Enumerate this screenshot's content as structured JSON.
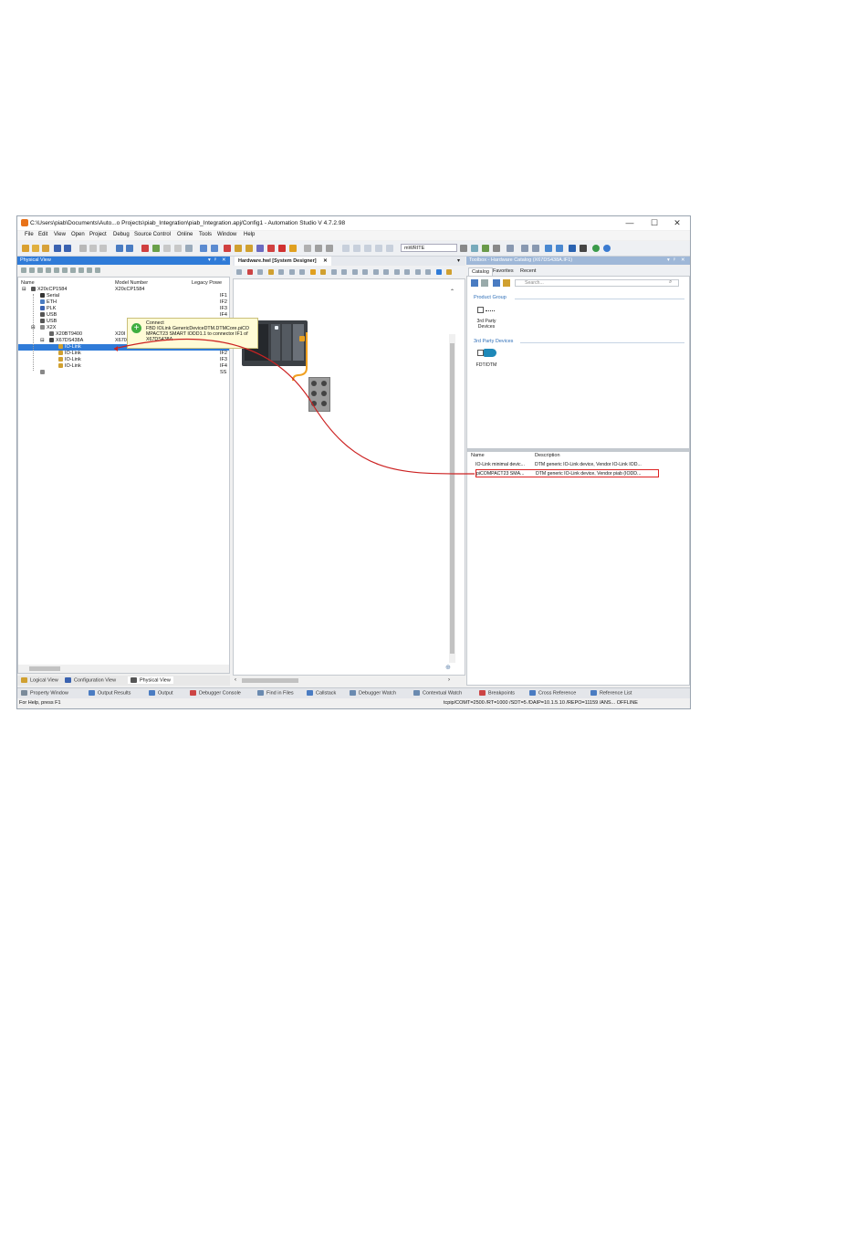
{
  "window": {
    "title": "C:\\Users\\piab\\Documents\\Auto...o Projects\\piab_Integration\\piab_Integration.apj/Config1 - Automation Studio V 4.7.2.98",
    "controls": [
      "—",
      "☐",
      "✕"
    ]
  },
  "menu": [
    "File",
    "Edit",
    "View",
    "Open",
    "Project",
    "Debug",
    "Source Control",
    "Online",
    "Tools",
    "Window",
    "Help"
  ],
  "toolbar": {
    "mode_select": "mWRITE"
  },
  "physical_view": {
    "title": "Physical View",
    "header_buttons": [
      "▾",
      "ᵖ",
      "✕"
    ],
    "columns": {
      "name": "Name",
      "model": "Model Number",
      "legacy": "Legacy Powe"
    },
    "rows": [
      {
        "name": "X20cCP1584",
        "model": "X20cCP1584",
        "port": "",
        "indent": 0,
        "expander": "⊟",
        "selected": false
      },
      {
        "name": "Serial",
        "model": "",
        "port": "IF1",
        "indent": 1,
        "expander": "",
        "selected": false
      },
      {
        "name": "ETH",
        "model": "",
        "port": "IF2",
        "indent": 1,
        "expander": "",
        "selected": false
      },
      {
        "name": "PLK",
        "model": "",
        "port": "IF3",
        "indent": 1,
        "expander": "",
        "selected": false
      },
      {
        "name": "USB",
        "model": "",
        "port": "IF4",
        "indent": 1,
        "expander": "",
        "selected": false
      },
      {
        "name": "USB",
        "model": "",
        "port": "",
        "indent": 1,
        "expander": "",
        "selected": false
      },
      {
        "name": "X2X",
        "model": "",
        "port": "",
        "indent": 1,
        "expander": "⊟",
        "selected": false
      },
      {
        "name": "X20BT9400",
        "model": "X20I",
        "port": "",
        "indent": 2,
        "expander": "",
        "selected": false
      },
      {
        "name": "X67DS438A",
        "model": "X670",
        "port": "",
        "indent": 2,
        "expander": "⊟",
        "selected": false
      },
      {
        "name": "IO-Link",
        "model": "",
        "port": "IF",
        "indent": 3,
        "expander": "",
        "selected": true
      },
      {
        "name": "IO-Link",
        "model": "",
        "port": "IF2",
        "indent": 3,
        "expander": "",
        "selected": false
      },
      {
        "name": "IO-Link",
        "model": "",
        "port": "IF3",
        "indent": 3,
        "expander": "",
        "selected": false
      },
      {
        "name": "IO-Link",
        "model": "",
        "port": "IF4",
        "indent": 3,
        "expander": "",
        "selected": false
      },
      {
        "name": "",
        "model": "",
        "port": "SS",
        "indent": 1,
        "expander": "",
        "selected": false
      }
    ],
    "tabs": [
      "Logical View",
      "Configuration View",
      "Physical View"
    ]
  },
  "tooltip": {
    "lines": [
      "Connect",
      "FBD IOLink GenericDeviceDTM.DTMCore.piCO",
      "MPACT23 SMART IODD1.1 to connector IF1 of",
      "X67DS438A"
    ]
  },
  "designer": {
    "tab_title": "Hardware.hwl [System Designer]",
    "tab_close": "✕",
    "pin": "▾"
  },
  "catalog": {
    "title": "Toolbox - Hardware Catalog (X67DS438A.IF1)",
    "header_buttons": [
      "▾",
      "ᵖ",
      "✕"
    ],
    "tabs": [
      "Catalog",
      "Favorites",
      "Recent"
    ],
    "search_placeholder": "Search...",
    "groups": [
      {
        "heading": "Product Group",
        "items": [
          "3rd Party",
          "Devices"
        ]
      },
      {
        "heading": "3rd Party Devices",
        "items": [
          "FDT/DTM"
        ]
      }
    ],
    "grid": {
      "columns": [
        "Name",
        "Description"
      ],
      "rows": [
        {
          "name": "IO-Link minimal devic...",
          "desc": "DTM generic IO-Link device, Vendor IO-Link IOD...",
          "highlighted": false
        },
        {
          "name": "piCOMPACT23 SMA...",
          "desc": "DTM generic IO-Link device, Vendor piab (IODD...",
          "highlighted": true
        }
      ]
    }
  },
  "bottom_tabs": [
    "Property Window",
    "Output Results",
    "Output",
    "Debugger Console",
    "Find in Files",
    "Callstack",
    "Debugger Watch",
    "Contextual Watch",
    "Breakpoints",
    "Cross Reference",
    "Reference List"
  ],
  "status": {
    "left": "For Help, press F1",
    "right": "tcpip/COMT=2500 /RT=1000 /SDT=5 /DAIP=10.1.5.10 /REPO=11159 /ANS... OFFLINE"
  },
  "colors": {
    "accent": "#2f7bd8",
    "connection_line": "#cc2222",
    "cable": "#f0a020",
    "highlight_box": "#dd2222"
  }
}
